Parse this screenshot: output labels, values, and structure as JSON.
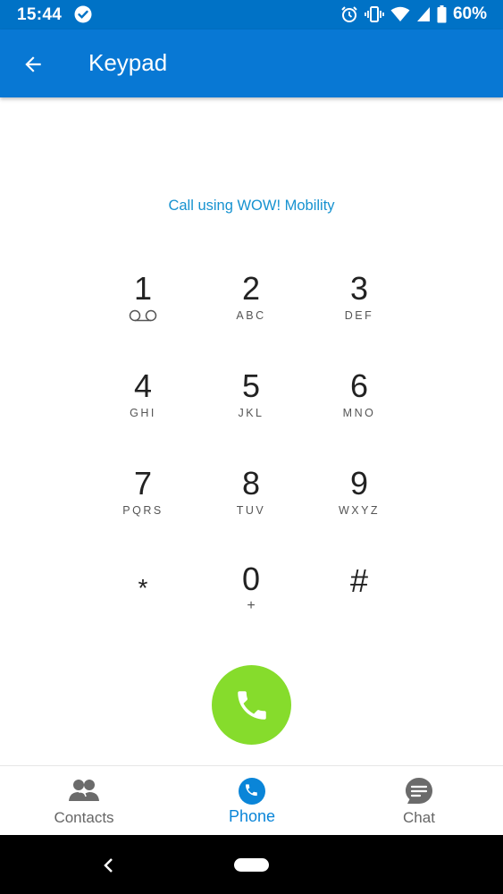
{
  "status_bar": {
    "time": "15:44",
    "battery": "60%",
    "icons": [
      "check-circle-icon",
      "alarm-icon",
      "vibrate-icon",
      "wifi-icon",
      "signal-icon",
      "battery-icon"
    ]
  },
  "app_bar": {
    "title": "Keypad",
    "back_icon": "arrow-left-icon",
    "color": "#0878d4"
  },
  "call_using": "Call using WOW! Mobility",
  "keypad": {
    "keys": [
      {
        "digit": "1",
        "letters": "",
        "symbol": "voicemail-icon"
      },
      {
        "digit": "2",
        "letters": "ABC"
      },
      {
        "digit": "3",
        "letters": "DEF"
      },
      {
        "digit": "4",
        "letters": "GHI"
      },
      {
        "digit": "5",
        "letters": "JKL"
      },
      {
        "digit": "6",
        "letters": "MNO"
      },
      {
        "digit": "7",
        "letters": "PQRS"
      },
      {
        "digit": "8",
        "letters": "TUV"
      },
      {
        "digit": "9",
        "letters": "WXYZ"
      },
      {
        "digit": "*",
        "letters": ""
      },
      {
        "digit": "0",
        "letters": "+"
      },
      {
        "digit": "#",
        "letters": ""
      }
    ]
  },
  "call_button": {
    "icon": "phone-icon",
    "color": "#86dc2c"
  },
  "bottom_nav": {
    "items": [
      {
        "label": "Contacts",
        "icon": "contacts-icon",
        "active": false
      },
      {
        "label": "Phone",
        "icon": "phone-icon",
        "active": true
      },
      {
        "label": "Chat",
        "icon": "chat-icon",
        "active": false
      }
    ],
    "active_color": "#0a85d8"
  }
}
